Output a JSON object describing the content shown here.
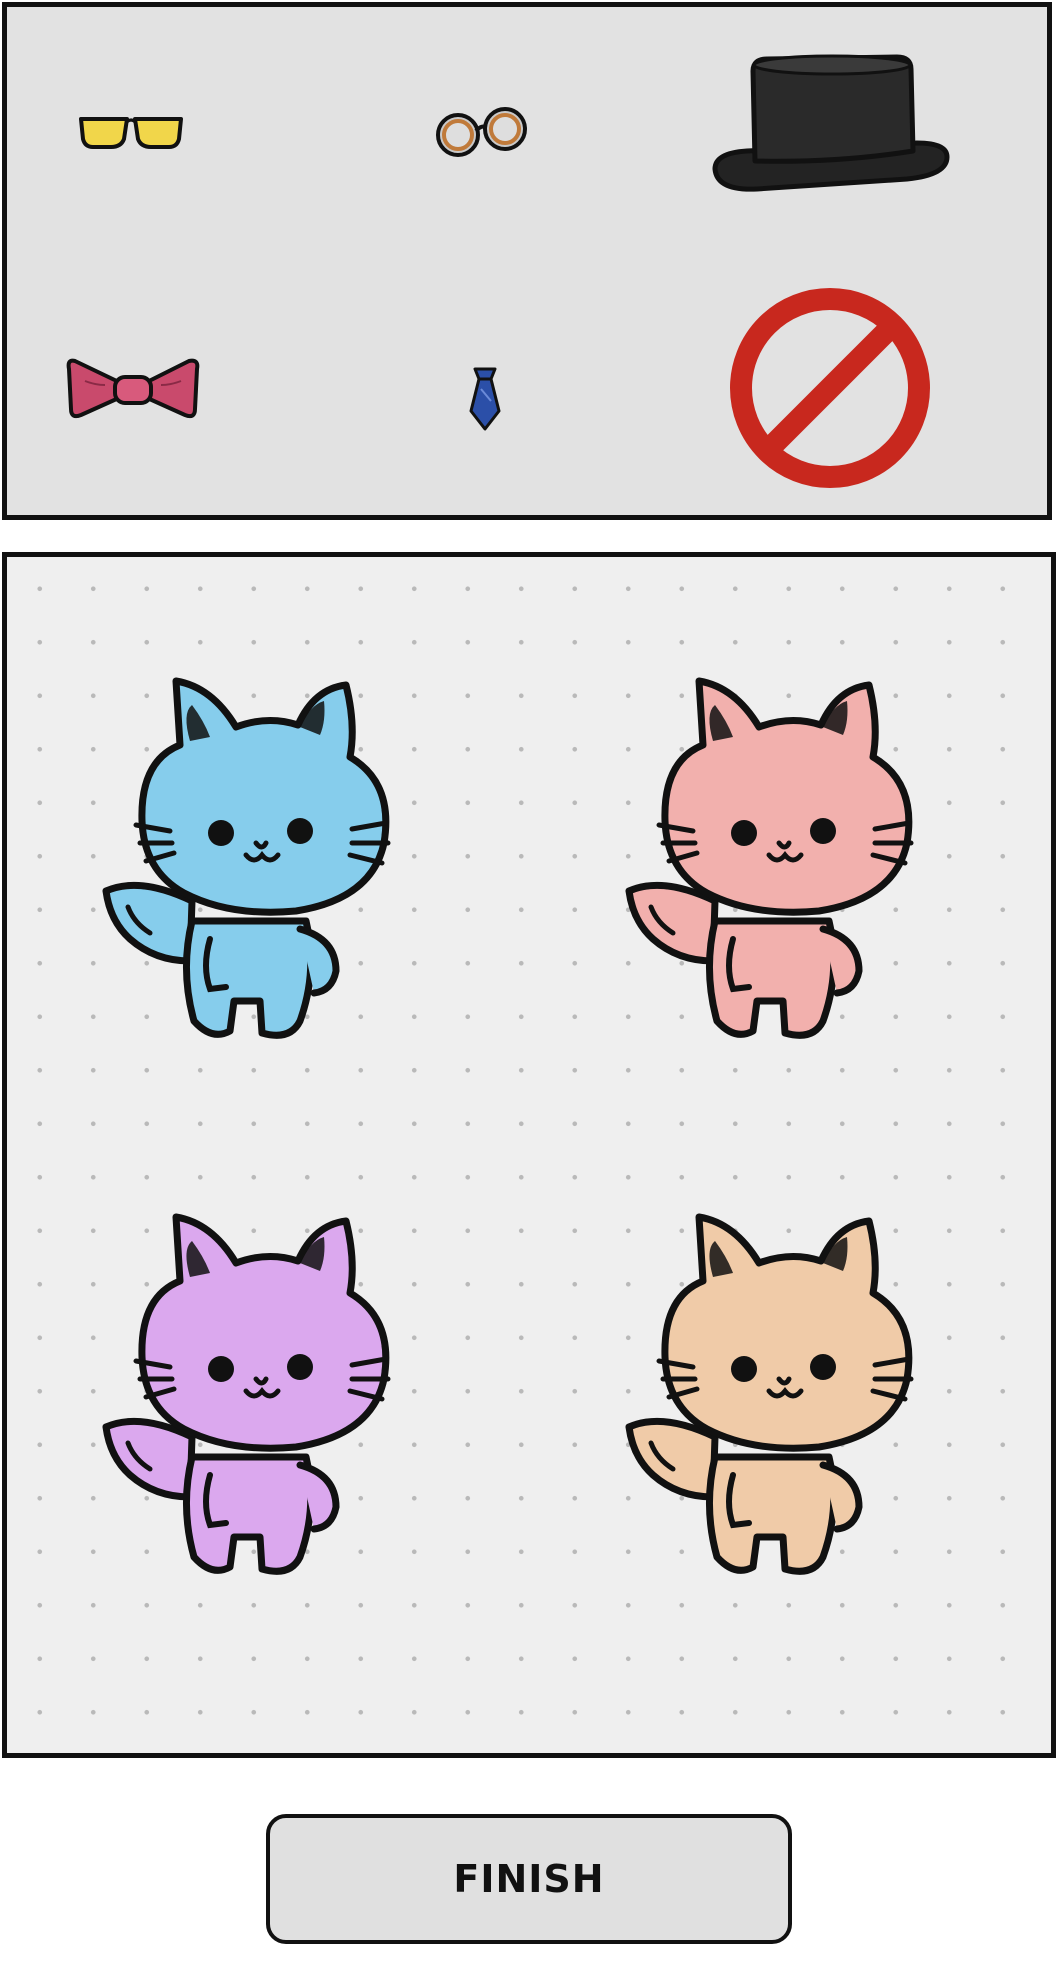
{
  "accessories": [
    {
      "id": "yellow-glasses",
      "icon": "yellow-glasses-icon",
      "color": "#f1d64a"
    },
    {
      "id": "round-spectacles",
      "icon": "round-spectacles-icon",
      "color": "#c07a3a"
    },
    {
      "id": "top-hat",
      "icon": "top-hat-icon",
      "color": "#232323"
    },
    {
      "id": "bow-tie",
      "icon": "bow-tie-icon",
      "color": "#c94a6c"
    },
    {
      "id": "necktie",
      "icon": "necktie-icon",
      "color": "#2b4fa8"
    },
    {
      "id": "none",
      "icon": "no-accessory-icon",
      "color": "#c8281e"
    }
  ],
  "cats": [
    {
      "color": "#86cdec"
    },
    {
      "color": "#f2b0ad"
    },
    {
      "color": "#dba8ee"
    },
    {
      "color": "#f0cba8"
    }
  ],
  "finish_label": "FINISH"
}
